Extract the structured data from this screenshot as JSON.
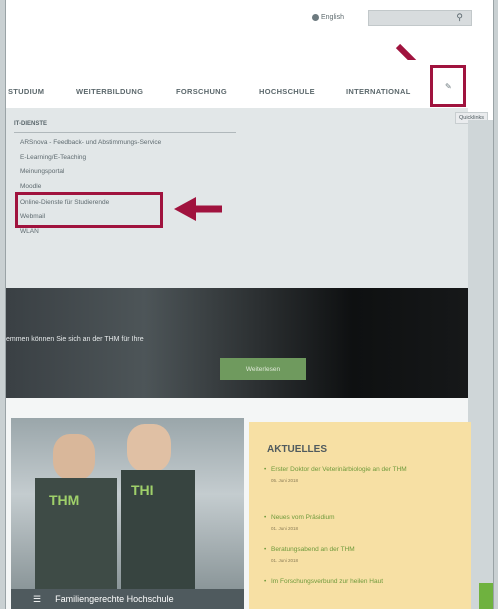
{
  "topbar": {
    "language_label": "English",
    "search_placeholder": ""
  },
  "nav": {
    "items": [
      "STUDIUM",
      "WEITERBILDUNG",
      "FORSCHUNG",
      "HOCHSCHULE",
      "INTERNATIONAL"
    ],
    "quicklinks_icon": "✎",
    "tooltip": "Quicklinks"
  },
  "dropdown": {
    "heading": "IT-DIENSTE",
    "items": [
      "ARSnova - Feedback- und Abstimmungs-Service",
      "E-Learning/E-Teaching",
      "Meinungsportal",
      "Moodle",
      "Online-Dienste für Studierende",
      "Webmail",
      "WLAN"
    ]
  },
  "hero": {
    "text": "emmen können Sie sich an der THM für Ihre",
    "button": "Weiterlesen"
  },
  "feature": {
    "shirt_left": "THM",
    "shirt_right": "THI",
    "label": "Familiengerechte Hochschule"
  },
  "news": {
    "heading": "AKTUELLES",
    "items": [
      {
        "title": "Erster Doktor der Veterinärbiologie an der THM",
        "date": "05. Juni 2018"
      },
      {
        "title": "Neues vom Präsidium",
        "date": "01. Juni 2018"
      },
      {
        "title": "Beratungsabend an der THM",
        "date": "01. Juni 2018"
      },
      {
        "title": "Im Forschungsverbund zur heilen Haut",
        "date": ""
      }
    ]
  },
  "colors": {
    "annotation": "#a0133e",
    "accent_green": "#6f9a5e",
    "news_bg": "#f7e0a4"
  }
}
